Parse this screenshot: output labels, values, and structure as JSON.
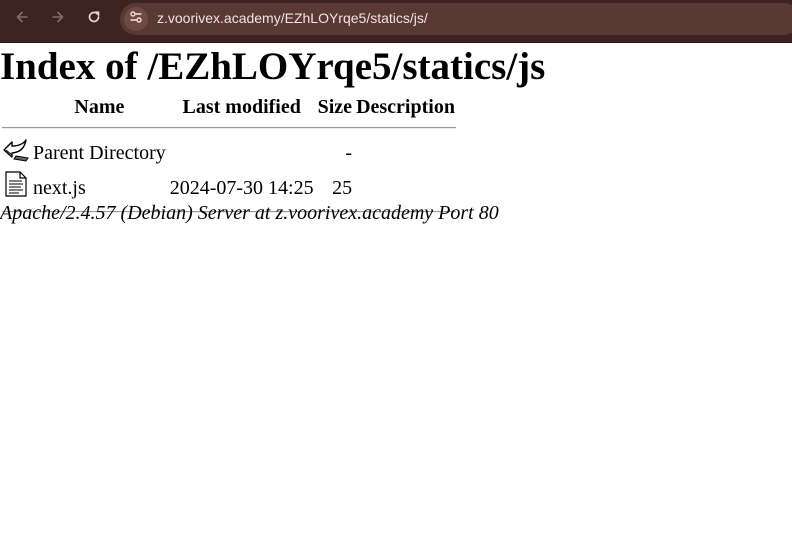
{
  "browser": {
    "url": "z.voorivex.academy/EZhLOYrqe5/statics/js/",
    "icons": {
      "back": "arrow-left-icon",
      "forward": "arrow-right-icon",
      "reload": "reload-icon",
      "site_info": "tune-icon"
    }
  },
  "page": {
    "title": "Index of /EZhLOYrqe5/statics/js"
  },
  "table": {
    "headers": {
      "name": "Name",
      "last_modified": "Last modified",
      "size": "Size",
      "description": "Description"
    },
    "rows": [
      {
        "icon": "parent-directory-icon",
        "name": "Parent Directory",
        "last_modified": "",
        "size": "-",
        "description": ""
      },
      {
        "icon": "text-file-icon",
        "name": "next.js",
        "last_modified": "2024-07-30 14:25",
        "size": "25",
        "description": ""
      }
    ]
  },
  "footer": {
    "text": "Apache/2.4.57 (Debian) Server at z.voorivex.academy Port 80"
  },
  "colors": {
    "toolbar_background": "#3d2320",
    "omnibox_background": "#5a3834",
    "url_text": "#f1e4e2"
  }
}
